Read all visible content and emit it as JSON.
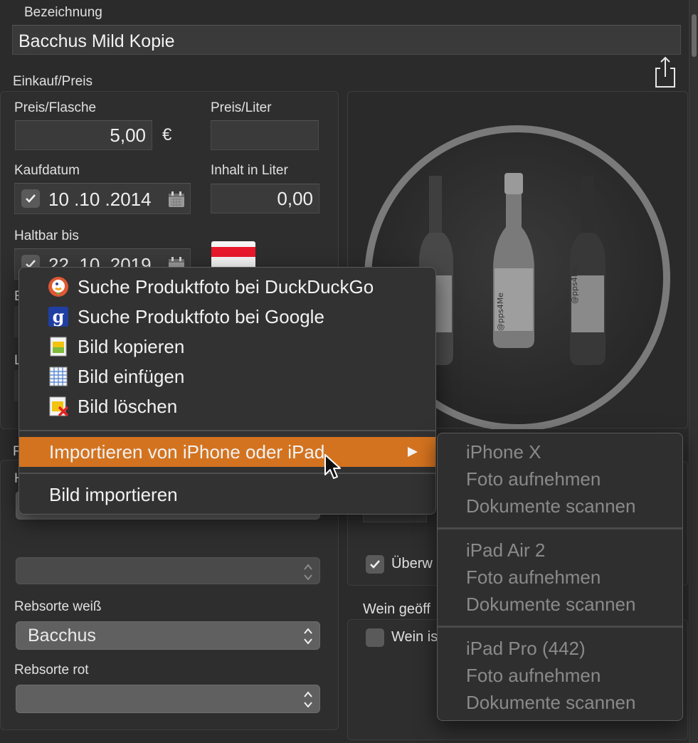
{
  "form": {
    "bezeichnung_label": "Bezeichnung",
    "bezeichnung_value": "Bacchus Mild Kopie",
    "einkauf_section": "Einkauf/Preis",
    "preis_flasche_label": "Preis/Flasche",
    "preis_flasche_value": "5,00",
    "currency": "€",
    "preis_liter_label": "Preis/Liter",
    "preis_liter_value": "",
    "kaufdatum_label": "Kaufdatum",
    "kaufdatum_value": "10 .10 .2014",
    "inhalt_label": "Inhalt in Liter",
    "inhalt_value": "0,00",
    "haltbar_label": "Haltbar bis",
    "haltbar_value": "22 .10 .2019",
    "rebsorte_weiss_label": "Rebsorte weiß",
    "rebsorte_weiss_value": "Bacchus",
    "rebsorte_rot_label": "Rebsorte rot",
    "rebsorte_rot_value": "",
    "ueberwachen_label": "Überw",
    "wein_geoeffnet_label": "Wein geöff",
    "wein_ist_label": "Wein is",
    "partial_label_e": "E",
    "partial_label_l": "L",
    "partial_label_f": "F",
    "partial_label_h": "H"
  },
  "bottle_label_text": "@pps4Me",
  "context_menu": {
    "items": [
      {
        "label": "Suche Produktfoto bei DuckDuckGo",
        "icon": "duckduckgo-icon"
      },
      {
        "label": "Suche Produktfoto bei Google",
        "icon": "google-icon"
      },
      {
        "label": "Bild kopieren",
        "icon": "copy-image-icon"
      },
      {
        "label": "Bild einfügen",
        "icon": "paste-image-icon"
      },
      {
        "label": "Bild löschen",
        "icon": "delete-image-icon"
      }
    ],
    "highlighted": "Importieren von iPhone oder iPad",
    "import": "Bild importieren"
  },
  "submenu": {
    "groups": [
      {
        "device": "iPhone X",
        "actions": [
          "Foto aufnehmen",
          "Dokumente scannen"
        ]
      },
      {
        "device": "iPad Air 2",
        "actions": [
          "Foto aufnehmen",
          "Dokumente scannen"
        ]
      },
      {
        "device": "iPad Pro (442)",
        "actions": [
          "Foto aufnehmen",
          "Dokumente scannen"
        ]
      }
    ]
  },
  "colors": {
    "highlight": "#d4731f",
    "background": "#2b2b2b",
    "flag_red": "#e8192c"
  }
}
